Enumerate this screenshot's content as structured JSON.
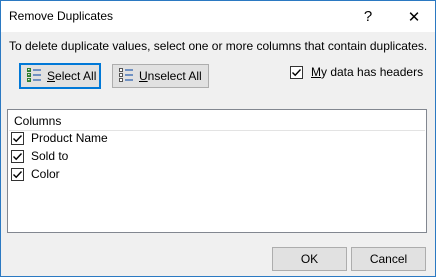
{
  "window": {
    "title": "Remove Duplicates",
    "help_glyph": "?",
    "close_glyph": "✕"
  },
  "instruction": "To delete duplicate values, select one or more columns that contain duplicates.",
  "toolbar": {
    "select_all_prefix": "",
    "select_all_accel": "S",
    "select_all_rest": "elect All",
    "unselect_all_accel": "U",
    "unselect_all_rest": "nselect All"
  },
  "headers_option": {
    "accel": "M",
    "rest": "y data has headers",
    "checked": true
  },
  "columns": {
    "header": "Columns",
    "items": [
      {
        "label": "Product Name",
        "checked": true
      },
      {
        "label": "Sold to",
        "checked": true
      },
      {
        "label": "Color",
        "checked": true
      }
    ]
  },
  "footer": {
    "ok_label": "OK",
    "cancel_label": "Cancel"
  },
  "colors": {
    "accent": "#0078d7",
    "titlebar": "#ffffff",
    "dialog_bg": "#f0f0f0",
    "list_bg": "#ffffff"
  },
  "icons": {
    "select_all": "checklist-icon",
    "unselect_all": "unchecklist-icon",
    "check": "checkmark-icon"
  }
}
